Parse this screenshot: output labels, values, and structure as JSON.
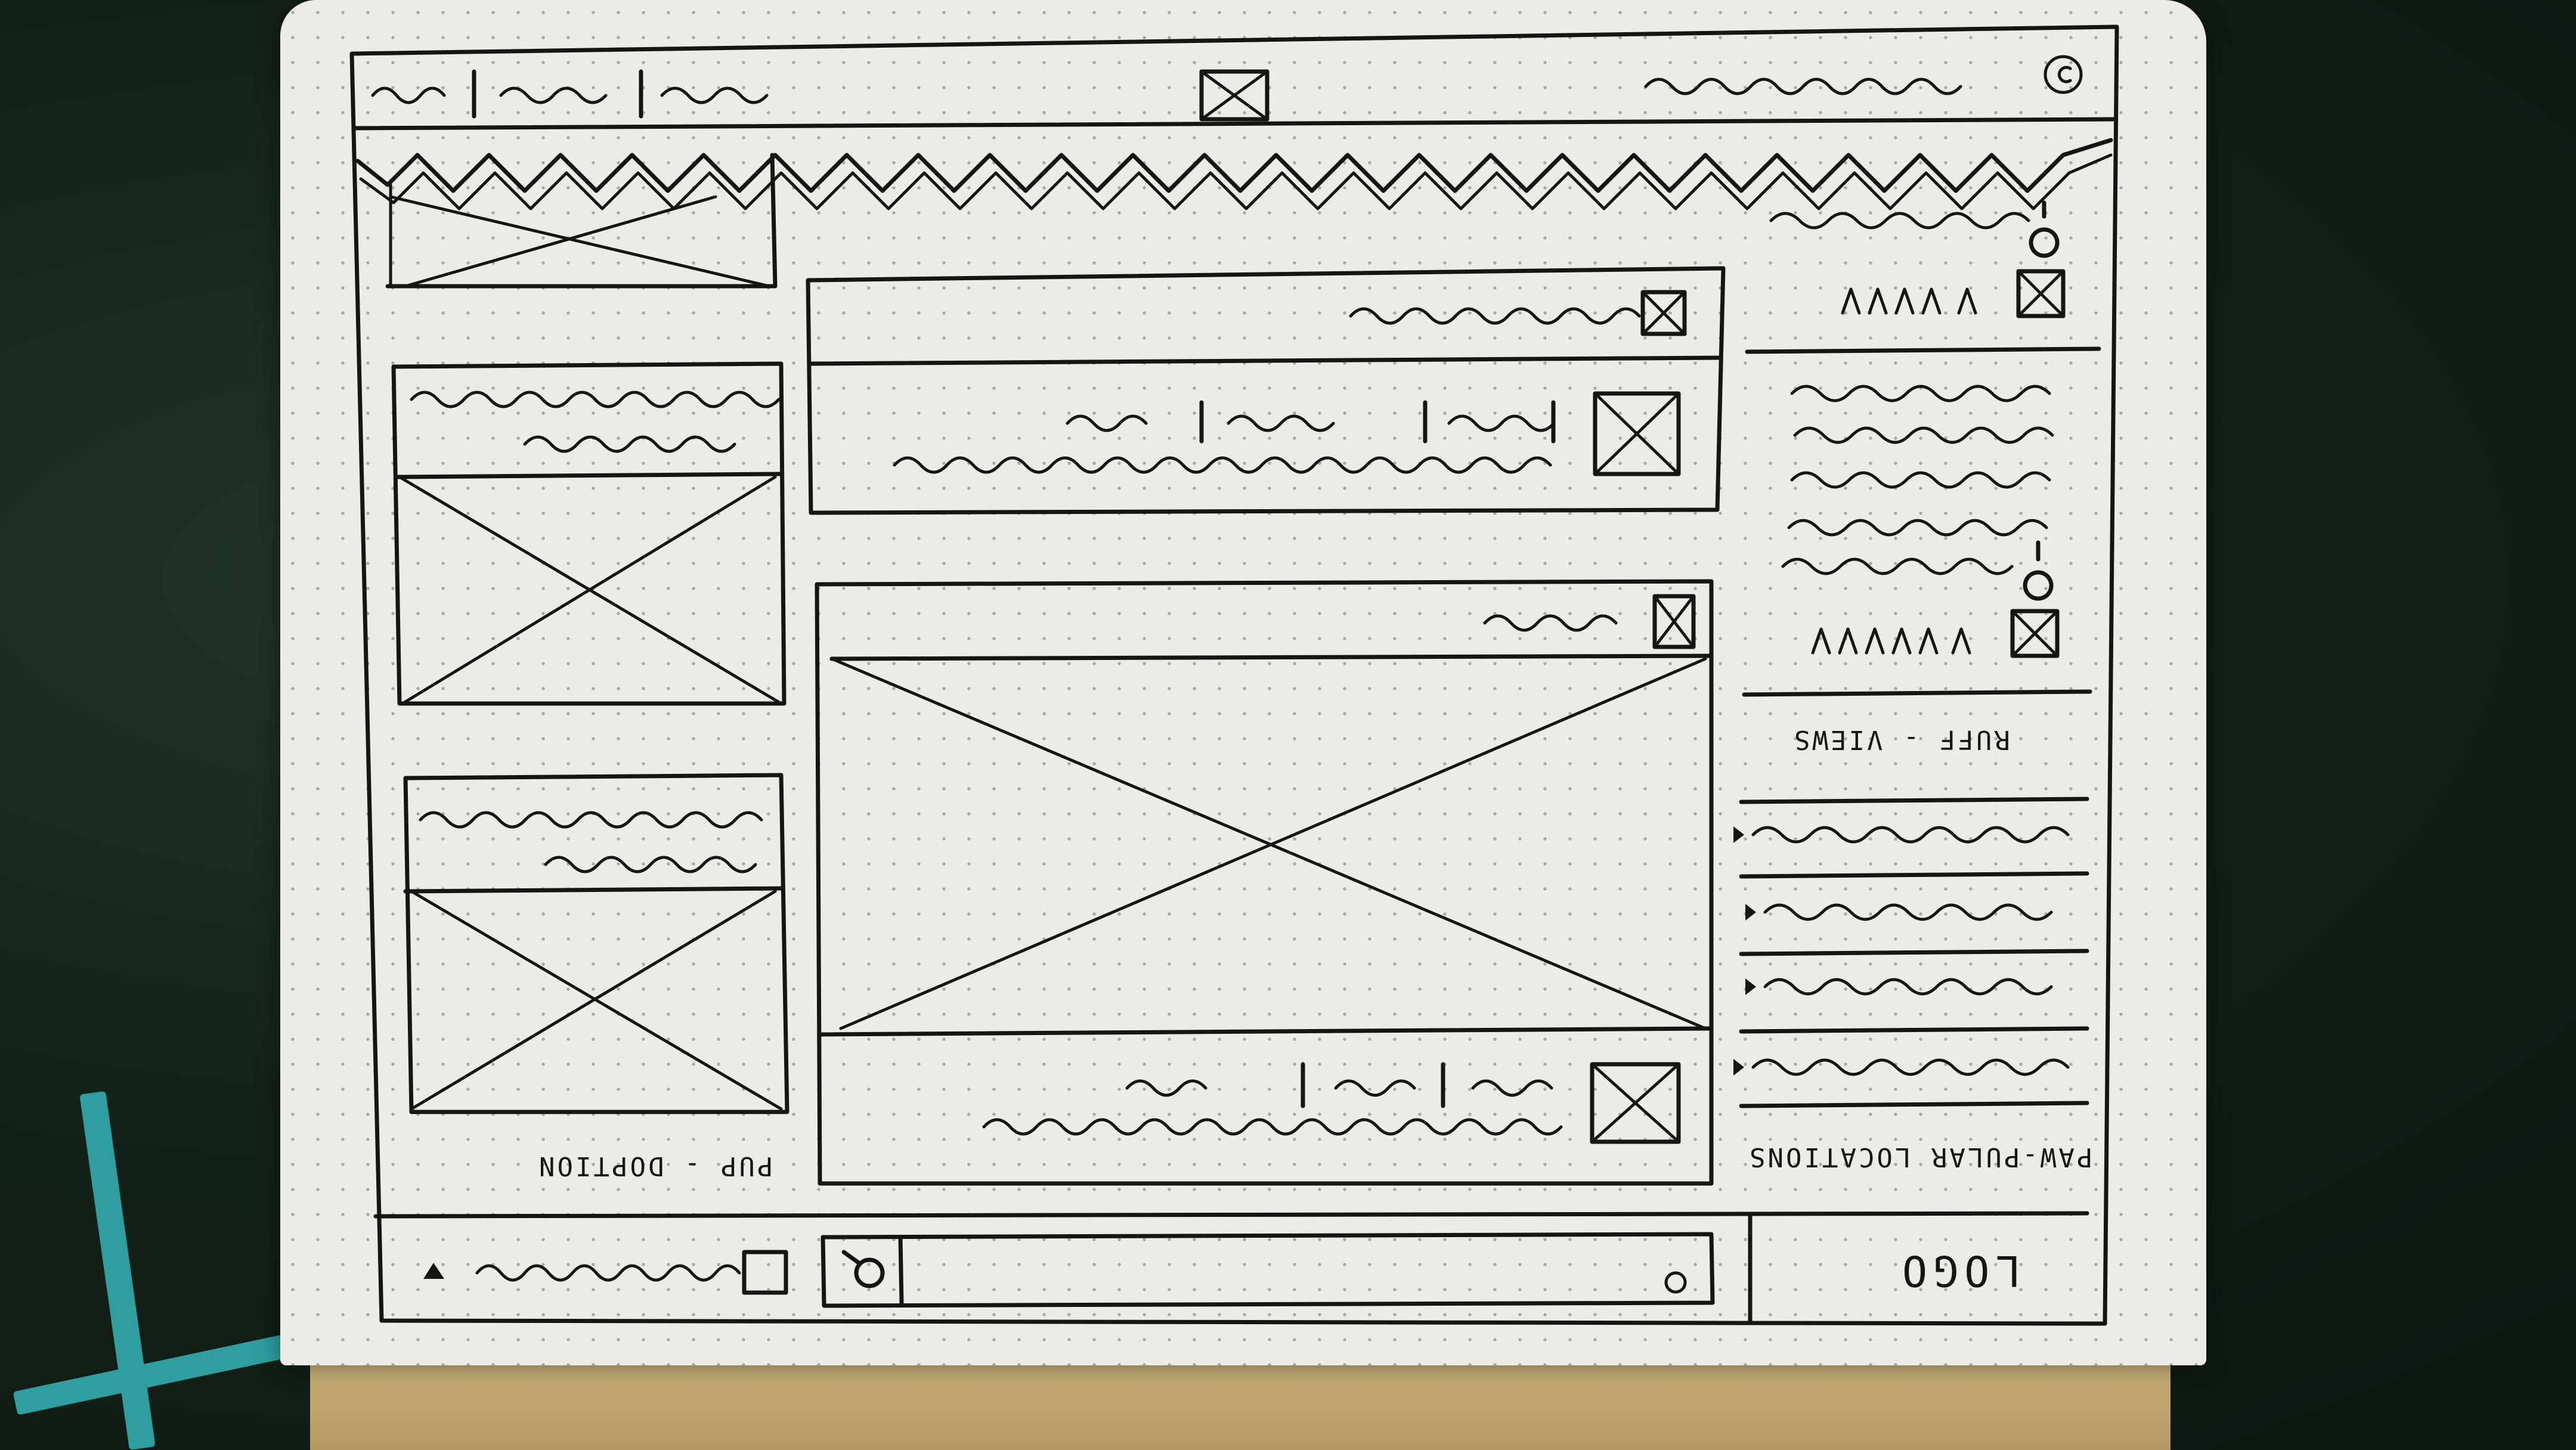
{
  "sketch": {
    "orientation": "upside-down",
    "ink_color": "#151512",
    "paper_color": "#ecebe6",
    "logo": {
      "text": "LOGO"
    },
    "search": {
      "icon": "search-icon",
      "filter_icon": "checkbox-icon",
      "dropdown_icon": "caret-down-icon"
    },
    "sidebar_left": {
      "sections": [
        {
          "title": "PAW-PULAR LOCATIONS",
          "items": 4
        },
        {
          "title": "RUFF - VIEWS",
          "icon": "location-pin-icon",
          "rating": 5
        }
      ]
    },
    "right_column": {
      "title": "PUP - DOPTION",
      "cards": 2
    },
    "feed": {
      "posts": 2,
      "icons": [
        "image-placeholder-icon",
        "image-placeholder-icon"
      ]
    },
    "footer": {
      "torn_edge": true,
      "center_icon": "image-placeholder-icon",
      "right_icon": "copyright-icon"
    }
  }
}
